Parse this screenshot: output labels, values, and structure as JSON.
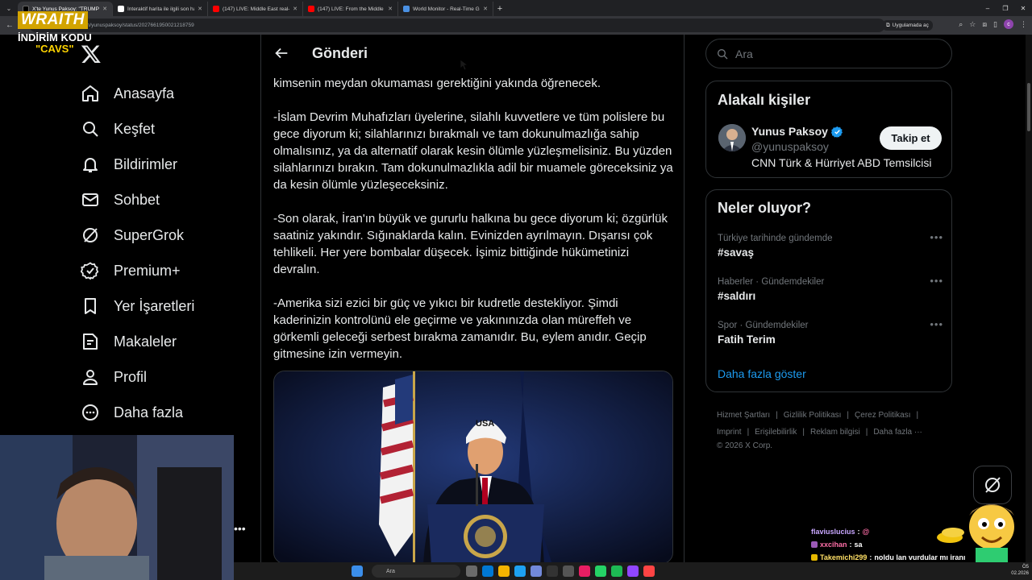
{
  "browser": {
    "tabs": [
      {
        "label": "X'te Yunus Paksoy: \"TRUMP'IN",
        "favicon_color": "#000000",
        "active": true
      },
      {
        "label": "İnteraktif harita ile ilgili son ha",
        "favicon_color": "#ffffff",
        "active": false
      },
      {
        "label": "(147) LIVE: Middle East real-tim",
        "favicon_color": "#ff0000",
        "active": false
      },
      {
        "label": "(147) LIVE: From the Middle Ea",
        "favicon_color": "#ff0000",
        "active": false
      },
      {
        "label": "World Monitor - Real-Time Glo",
        "favicon_color": "#4a90e2",
        "active": false
      }
    ],
    "url": "x.com/yunuspaksoy/status/2027661950021218759",
    "app_pill": "Uygulamada aç",
    "profile_initial": "c"
  },
  "overlay": {
    "brand": "WRAITH",
    "code_line": "İNDİRİM KODU",
    "code_name": "\"CAVS\""
  },
  "nav": {
    "items": [
      {
        "label": "Anasayfa",
        "icon": "home-icon"
      },
      {
        "label": "Keşfet",
        "icon": "search-icon"
      },
      {
        "label": "Bildirimler",
        "icon": "bell-icon"
      },
      {
        "label": "Sohbet",
        "icon": "mail-icon"
      },
      {
        "label": "SuperGrok",
        "icon": "grok-icon"
      },
      {
        "label": "Premium+",
        "icon": "verified-icon"
      },
      {
        "label": "Yer İşaretleri",
        "icon": "bookmark-icon"
      },
      {
        "label": "Makaleler",
        "icon": "article-icon"
      },
      {
        "label": "Profil",
        "icon": "person-icon"
      },
      {
        "label": "Daha fazla",
        "icon": "more-circle-icon"
      }
    ],
    "more_dots": "•••"
  },
  "main": {
    "title": "Gönderi",
    "paragraphs": [
      "kimsenin meydan okumaması gerektiğini yakında öğrenecek.",
      "-İslam Devrim Muhafızları üyelerine, silahlı kuvvetlere ve tüm polislere bu gece diyorum ki; silahlarınızı bırakmalı ve tam dokunulmazlığa sahip olmalısınız, ya da alternatif olarak kesin ölümle yüzleşmelisiniz. Bu yüzden silahlarınızı bırakın. Tam dokunulmazlıkla adil bir muamele göreceksiniz ya da kesin ölümle yüzleşeceksiniz.",
      "-Son olarak, İran'ın büyük ve gururlu halkına bu gece diyorum ki; özgürlük saatiniz yakındır. Sığınaklarda kalın. Evinizden ayrılmayın. Dışarısı çok tehlikeli. Her yere bombalar düşecek. İşimiz bittiğinde hükümetinizi devralın.",
      "-Amerika sizi ezici bir güç ve yıkıcı bir kudretle destekliyor. Şimdi kaderinizin kontrolünü ele geçirme ve yakınınızda olan müreffeh ve görkemli geleceği serbest bırakma zamanıdır. Bu, eylem anıdır. Geçip gitmesine izin vermeyin."
    ],
    "media_cap_text": "USA"
  },
  "sidebar": {
    "search_placeholder": "Ara",
    "relevant": {
      "title": "Alakalı kişiler",
      "name": "Yunus Paksoy",
      "handle": "@yunuspaksoy",
      "bio": "CNN Türk & Hürriyet ABD Temsilcisi",
      "follow_label": "Takip et"
    },
    "trending": {
      "title": "Neler oluyor?",
      "items": [
        {
          "meta": "Türkiye tarihinde gündemde",
          "topic": "#savaş"
        },
        {
          "meta": "Haberler · Gündemdekiler",
          "topic": "#saldırı"
        },
        {
          "meta": "Spor · Gündemdekiler",
          "topic": "Fatih Terim"
        }
      ],
      "dots": "•••",
      "show_more": "Daha fazla göster"
    },
    "footer": {
      "links_row1": [
        "Hizmet Şartları",
        "Gizlilik Politikası",
        "Çerez Politikası"
      ],
      "links_row2": [
        "Imprint",
        "Erişilebilirlik",
        "Reklam bilgisi",
        "Daha fazla ···"
      ],
      "copyright": "© 2026 X Corp."
    }
  },
  "chat": [
    {
      "user": "flaviuslucius",
      "user_color": "#c9a7ff",
      "badge_color": "#9b59b6",
      "msg": "@"
    },
    {
      "user": "xxcihan",
      "user_color": "#ff6fa8",
      "badge_color": "#9b59b6",
      "msg": "sa"
    },
    {
      "user": "Takemichi299",
      "user_color": "#ffe066",
      "badge_color": "#e6b800",
      "msg": "noldu lan vurdular mı iranı"
    }
  ],
  "taskbar": {
    "search_label": "Ara",
    "clock": "Ö5",
    "date": "02.2026"
  },
  "colors": {
    "accent": "#1d9bf0",
    "background": "#000000",
    "border": "#2f3336",
    "muted": "#71767b"
  }
}
